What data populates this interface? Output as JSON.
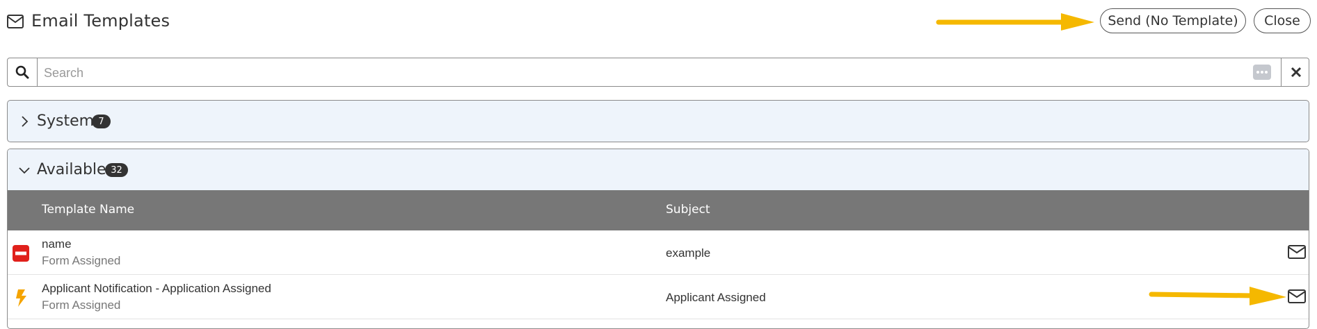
{
  "header": {
    "title": "Email Templates",
    "send_no_template_label": "Send (No Template)",
    "close_label": "Close"
  },
  "search": {
    "placeholder": "Search",
    "value": ""
  },
  "sections": {
    "system": {
      "label": "System",
      "count": "7",
      "expanded": false
    },
    "available": {
      "label": "Available",
      "count": "32",
      "expanded": true
    }
  },
  "table": {
    "columns": [
      "Template Name",
      "Subject"
    ],
    "rows": [
      {
        "name": "Form Assigned",
        "title": "name",
        "subject": "example",
        "icon": "disabled-minus-icon"
      },
      {
        "name": "Form Assigned",
        "title": "Applicant Notification - Application Assigned",
        "subject": "Applicant Assigned",
        "icon": "lightning-bolt-icon"
      }
    ]
  },
  "colors": {
    "table_header": "#777777",
    "section_bg": "#eef4fb",
    "annotation_arrow": "#f5b800",
    "disabled_icon": "#e0201b",
    "bolt_icon": "#f5a400"
  }
}
